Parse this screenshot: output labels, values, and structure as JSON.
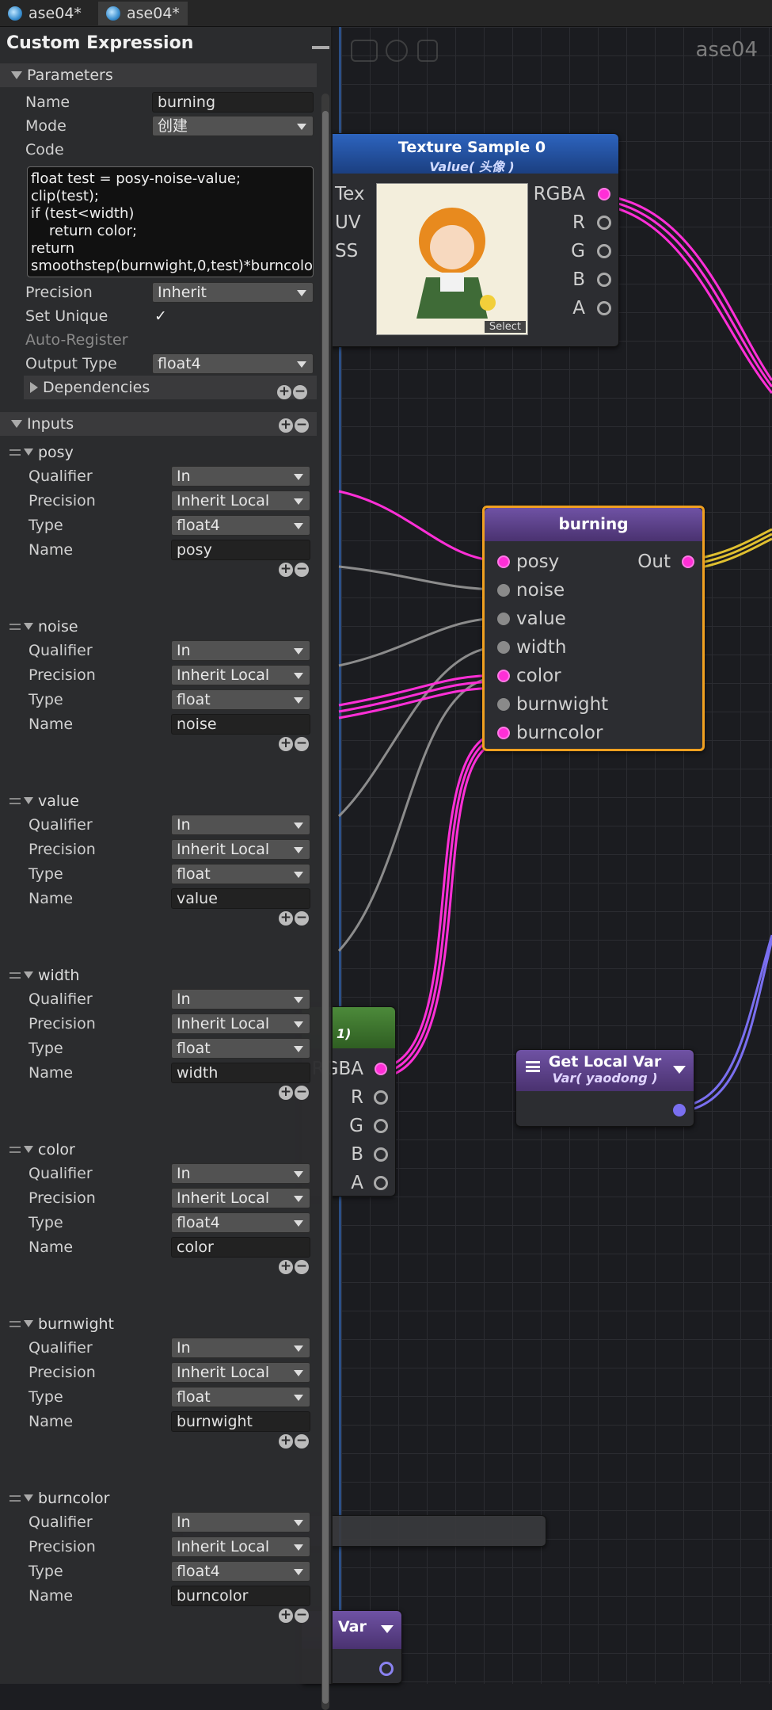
{
  "tabs": [
    {
      "label": "ase04*"
    },
    {
      "label": "ase04*"
    }
  ],
  "canvas": {
    "title": "ase04"
  },
  "panel": {
    "title": "Custom Expression",
    "parameters": {
      "header": "Parameters",
      "name_label": "Name",
      "name_value": "burning",
      "mode_label": "Mode",
      "mode_value": "创建",
      "code_label": "Code",
      "code_value": "float test = posy-noise-value;\nclip(test);\nif (test<width)\n    return color;\nreturn\nsmoothstep(burnwight,0,test)*burncolo",
      "precision_label": "Precision",
      "precision_value": "Inherit",
      "set_unique_label": "Set Unique",
      "set_unique_checked": "✓",
      "auto_register_label": "Auto-Register",
      "output_type_label": "Output Type",
      "output_type_value": "float4",
      "dependencies_label": "Dependencies"
    },
    "inputs_header": "Inputs",
    "field_labels": {
      "qualifier": "Qualifier",
      "precision": "Precision",
      "type": "Type",
      "name": "Name"
    },
    "inputs": [
      {
        "title": "posy",
        "qualifier": "In",
        "precision": "Inherit Local",
        "type": "float4",
        "name": "posy"
      },
      {
        "title": "noise",
        "qualifier": "In",
        "precision": "Inherit Local",
        "type": "float",
        "name": "noise"
      },
      {
        "title": "value",
        "qualifier": "In",
        "precision": "Inherit Local",
        "type": "float",
        "name": "value"
      },
      {
        "title": "width",
        "qualifier": "In",
        "precision": "Inherit Local",
        "type": "float",
        "name": "width"
      },
      {
        "title": "color",
        "qualifier": "In",
        "precision": "Inherit Local",
        "type": "float4",
        "name": "color"
      },
      {
        "title": "burnwight",
        "qualifier": "In",
        "precision": "Inherit Local",
        "type": "float",
        "name": "burnwight"
      },
      {
        "title": "burncolor",
        "qualifier": "In",
        "precision": "Inherit Local",
        "type": "float4",
        "name": "burncolor"
      }
    ]
  },
  "nodes": {
    "texture": {
      "title": "Texture Sample 0",
      "subtitle": "Value( 头像 )",
      "select_label": "Select",
      "inputs": [
        "Tex",
        "UV",
        "SS"
      ],
      "outputs": [
        "RGBA",
        "R",
        "G",
        "B",
        "A"
      ]
    },
    "burning": {
      "title": "burning",
      "inputs": [
        "posy",
        "noise",
        "value",
        "width",
        "color",
        "burnwight",
        "burncolor"
      ],
      "output": "Out"
    },
    "texture2": {
      "subtitle": "1)",
      "outputs": [
        "RGBA",
        "R",
        "G",
        "B",
        "A"
      ]
    },
    "get_local_var": {
      "title": "Get Local Var",
      "subtitle": "Var( yaodong )"
    },
    "register_var": {
      "title": "Var"
    }
  },
  "colors": {
    "accent_magenta": "#ff2fd7",
    "node_header_purple": "#5a3f86",
    "texture_header_blue": "#1f4f9e",
    "selection_orange": "#f0a020",
    "wire_yellow": "#e0c030",
    "wire_blue": "#7a6ff0"
  }
}
